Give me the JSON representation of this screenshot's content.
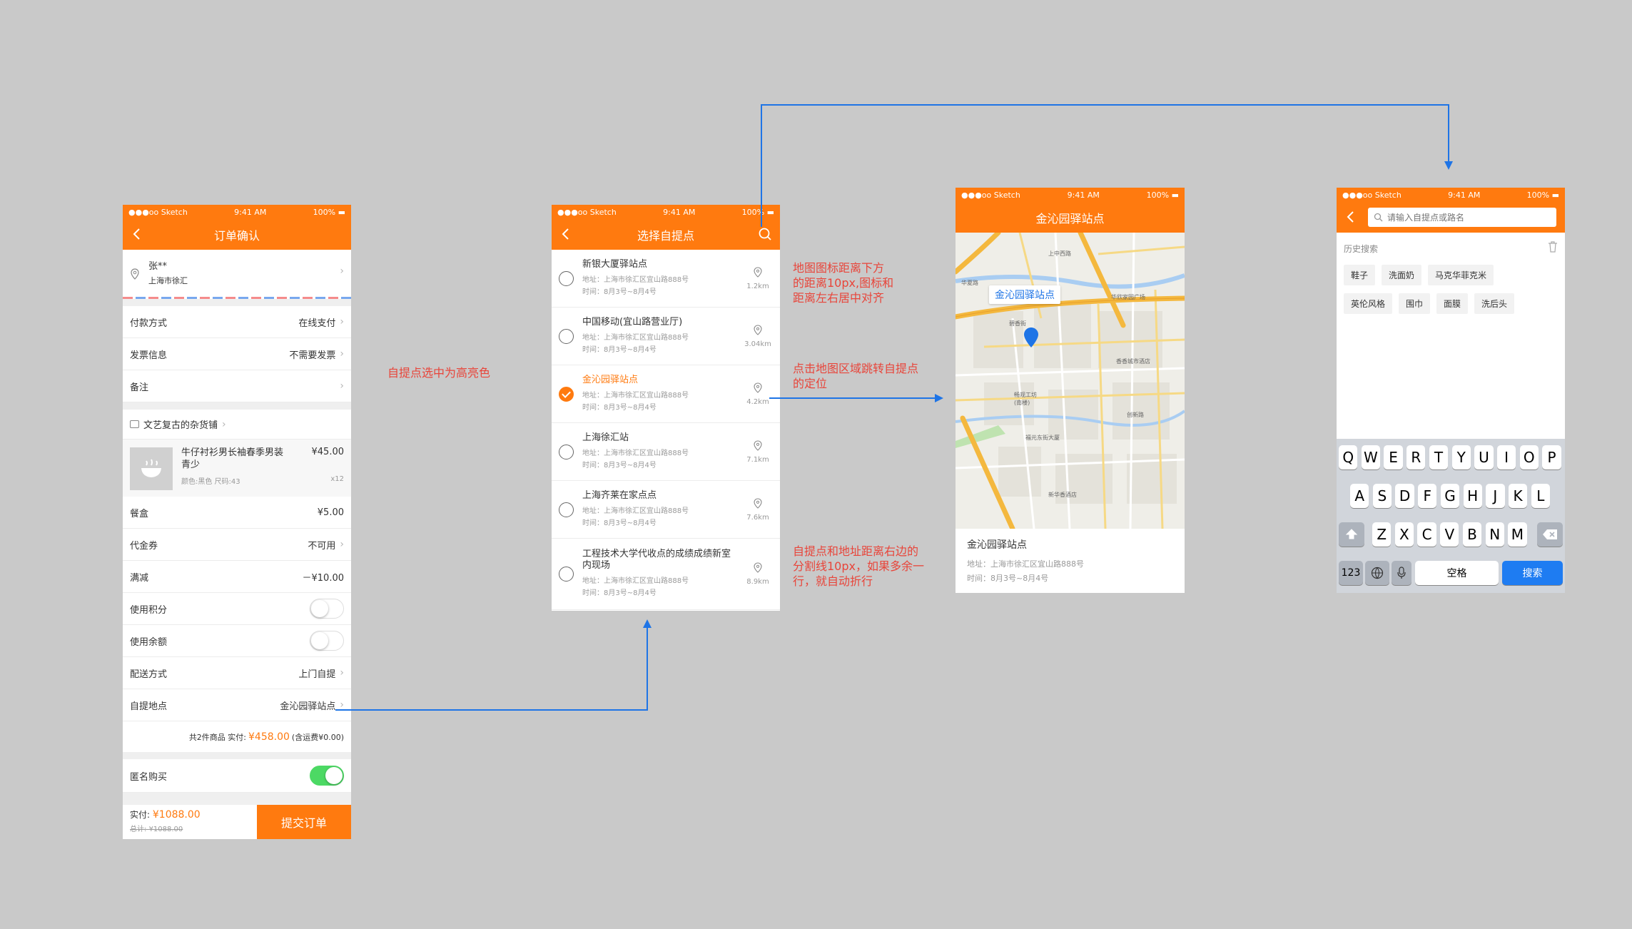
{
  "status": {
    "carrier": "●●●oo Sketch",
    "time": "9:41 AM",
    "battery": "100%"
  },
  "order": {
    "title": "订单确认",
    "addr_name": "张**",
    "addr_line": "上海市徐汇",
    "rows": [
      {
        "label": "付款方式",
        "value": "在线支付"
      },
      {
        "label": "发票信息",
        "value": "不需要发票"
      },
      {
        "label": "备注",
        "value": ""
      }
    ],
    "shop": "文艺复古的杂货铺",
    "product": {
      "name": "牛仔衬衫男长袖春季男装青少",
      "price": "¥45.00",
      "spec": "颜色:黑色   尺码:43",
      "qty": "x12"
    },
    "rows2": [
      {
        "label": "餐盒",
        "value": "¥5.00"
      },
      {
        "label": "代金券",
        "value": "不可用"
      },
      {
        "label": "满减",
        "value": "－¥10.00"
      }
    ],
    "points_label": "使用积分",
    "balance_label": "使用余额",
    "delivery_label": "配送方式",
    "delivery_value": "上门自提",
    "pickup_label": "自提地点",
    "pickup_value": "金沁园驿站点",
    "summary_count": "共2件商品   实付:",
    "summary_amount": "¥458.00",
    "summary_freight": "(含运费¥0.00)",
    "anon_label": "匿名购买",
    "pay_label": "实付:",
    "pay_amount": "¥1088.00",
    "total_label": "总计:",
    "total_amount": "¥1088.00",
    "submit": "提交订单"
  },
  "pickup": {
    "title": "选择自提点",
    "sites": [
      {
        "name": "新银大厦驿站点",
        "addr": "地址：上海市徐汇区宜山路888号",
        "time": "时间：8月3号~8月4号",
        "dist": "1.2km",
        "selected": false
      },
      {
        "name": "中国移动(宜山路营业厅)",
        "addr": "地址：上海市徐汇区宜山路888号",
        "time": "时间：8月3号~8月4号",
        "dist": "3.04km",
        "selected": false
      },
      {
        "name": "金沁园驿站点",
        "addr": "地址：上海市徐汇区宜山路888号",
        "time": "时间：8月3号~8月4号",
        "dist": "4.2km",
        "selected": true
      },
      {
        "name": "上海徐汇站",
        "addr": "地址：上海市徐汇区宜山路888号",
        "time": "时间：8月3号~8月4号",
        "dist": "7.1km",
        "selected": false
      },
      {
        "name": "上海齐莱在家点点",
        "addr": "地址：上海市徐汇区宜山路888号",
        "time": "时间：8月3号~8月4号",
        "dist": "7.6km",
        "selected": false
      },
      {
        "name": "工程技术大学代收点的成绩成绩新室内现场",
        "addr": "地址：上海市徐汇区宜山路888号",
        "time": "时间：8月3号~8月4号",
        "dist": "8.9km",
        "selected": false
      }
    ]
  },
  "map_page": {
    "title": "金沁园驿站点",
    "bubble": "金沁园驿站点",
    "name": "金沁园驿站点",
    "addr": "地址：上海市徐汇区宜山路888号",
    "time": "时间：8月3号~8月4号",
    "poi": [
      "上中西路",
      "华夏路",
      "华欣家园广场",
      "碧香街",
      "香香城市酒店",
      "畅观工坊(南楼)",
      "福元东街大厦",
      "新华香酒店",
      "创新路"
    ]
  },
  "search_page": {
    "placeholder": "请输入自提点或路名",
    "history_label": "历史搜索",
    "tags": [
      [
        "鞋子",
        "洗面奶",
        "马克华菲克米"
      ],
      [
        "英伦风格",
        "围巾",
        "面膜",
        "洗后头"
      ]
    ],
    "row1": [
      "Q",
      "W",
      "E",
      "R",
      "T",
      "Y",
      "U",
      "I",
      "O",
      "P"
    ],
    "row2": [
      "A",
      "S",
      "D",
      "F",
      "G",
      "H",
      "J",
      "K",
      "L"
    ],
    "row3": [
      "Z",
      "X",
      "C",
      "V",
      "B",
      "N",
      "M"
    ],
    "num_key": "123",
    "space_key": "空格",
    "search_key": "搜索"
  },
  "notes": {
    "n1": "自提点选中为高亮色",
    "n2": "地图图标距离下方\n的距离10px,图标和\n距离左右居中对齐",
    "n3": "点击地图区域跳转自提点\n的定位",
    "n4": "自提点和地址距离右边的\n分割线10px，如果多余一\n行，就自动折行"
  },
  "colors": {
    "brand": "#ff7a0f",
    "link": "#1e74e6",
    "note": "#e8453a",
    "switch_on": "#4cd964"
  }
}
